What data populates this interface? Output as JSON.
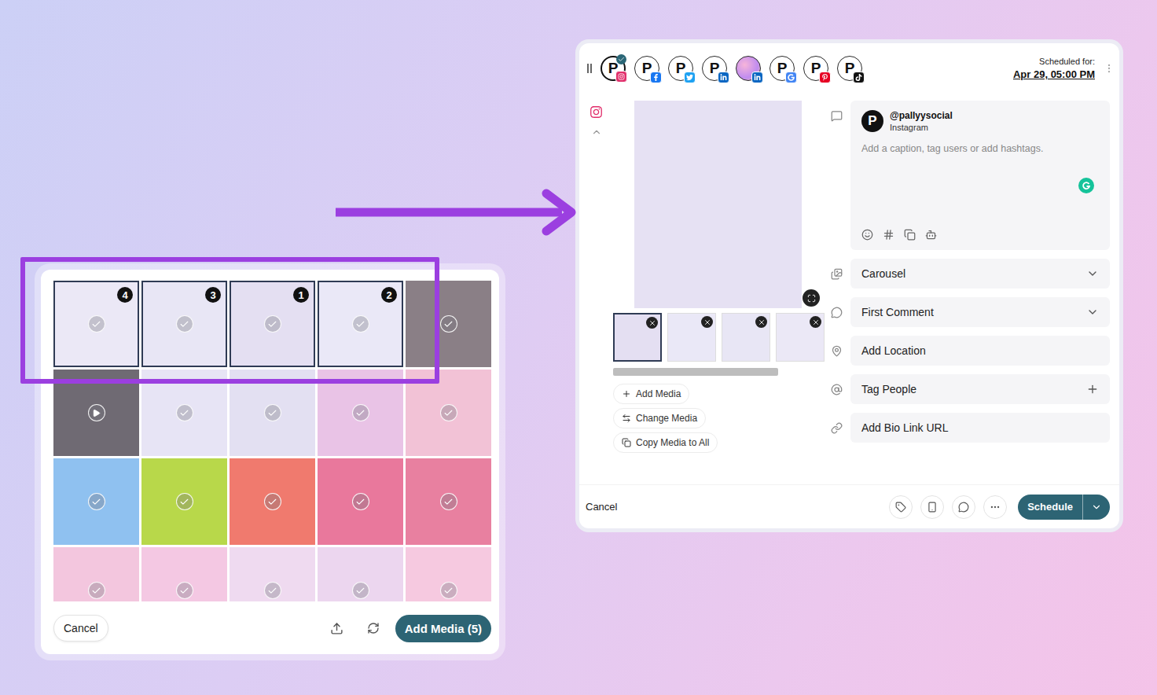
{
  "media_picker": {
    "thumbnails": [
      {
        "kind": "image",
        "color": "#ebe8f6",
        "selected": true,
        "order": "4"
      },
      {
        "kind": "image",
        "color": "#e8e6f5",
        "selected": true,
        "order": "3"
      },
      {
        "kind": "image",
        "color": "#e4dff2",
        "selected": true,
        "order": "1"
      },
      {
        "kind": "image",
        "color": "#eae8f7",
        "selected": true,
        "order": "2"
      },
      {
        "kind": "image",
        "color": "#8a7f86",
        "selected": false,
        "order": ""
      },
      {
        "kind": "video",
        "color": "#6f6a73",
        "selected": false,
        "order": ""
      },
      {
        "kind": "image",
        "color": "#e7e4f5",
        "selected": false,
        "order": ""
      },
      {
        "kind": "image",
        "color": "#e3e0f2",
        "selected": false,
        "order": ""
      },
      {
        "kind": "image",
        "color": "#e9c3e6",
        "selected": false,
        "order": ""
      },
      {
        "kind": "image",
        "color": "#f2c2d6",
        "selected": false,
        "order": ""
      },
      {
        "kind": "image",
        "color": "#8fc1f0",
        "selected": false,
        "order": ""
      },
      {
        "kind": "image",
        "color": "#b8d84a",
        "selected": false,
        "order": ""
      },
      {
        "kind": "image",
        "color": "#f07a6e",
        "selected": false,
        "order": ""
      },
      {
        "kind": "image",
        "color": "#e9789c",
        "selected": false,
        "order": ""
      },
      {
        "kind": "image",
        "color": "#e880a0",
        "selected": false,
        "order": ""
      },
      {
        "kind": "image",
        "color": "#f3c6de",
        "selected": false,
        "order": ""
      },
      {
        "kind": "image",
        "color": "#f4c8e3",
        "selected": false,
        "order": ""
      },
      {
        "kind": "image",
        "color": "#efdaf0",
        "selected": false,
        "order": ""
      },
      {
        "kind": "image",
        "color": "#ecd6ef",
        "selected": false,
        "order": ""
      },
      {
        "kind": "image",
        "color": "#f6c9e0",
        "selected": false,
        "order": ""
      }
    ],
    "cancel": "Cancel",
    "add": "Add Media (5)"
  },
  "composer": {
    "accounts": [
      {
        "platform": "instagram",
        "kind": "logo",
        "selected": true
      },
      {
        "platform": "facebook",
        "kind": "logo",
        "selected": false
      },
      {
        "platform": "twitter",
        "kind": "logo",
        "selected": false
      },
      {
        "platform": "linkedin",
        "kind": "logo",
        "selected": false
      },
      {
        "platform": "linkedin",
        "kind": "photo",
        "selected": false
      },
      {
        "platform": "google",
        "kind": "logo",
        "selected": false
      },
      {
        "platform": "pinterest",
        "kind": "logo",
        "selected": false
      },
      {
        "platform": "tiktok",
        "kind": "logo",
        "selected": false
      }
    ],
    "logo": "P",
    "schedule": {
      "label": "Scheduled for:",
      "value": "Apr 29, 05:00 PM"
    },
    "preview": {
      "color": "#e6e1f3"
    },
    "media_strip": [
      {
        "color": "#e4dff2",
        "selected": true
      },
      {
        "color": "#eae8f7",
        "selected": false
      },
      {
        "color": "#e8e6f5",
        "selected": false
      },
      {
        "color": "#ebe8f6",
        "selected": false
      }
    ],
    "media_actions": [
      {
        "label": "Add Media",
        "kind": "add"
      },
      {
        "label": "Change Media",
        "kind": "change"
      },
      {
        "label": "Copy Media to All",
        "kind": "copy"
      }
    ],
    "profile": {
      "handle": "@pallyysocial",
      "network": "Instagram"
    },
    "caption": {
      "placeholder": "Add a caption, tag users or add hashtags."
    },
    "fields": [
      {
        "label": "Carousel",
        "kind": "dropdown",
        "icon": "images"
      },
      {
        "label": "First Comment",
        "kind": "dropdown",
        "icon": "comment"
      },
      {
        "label": "Add Location",
        "kind": "plain",
        "icon": "location"
      },
      {
        "label": "Tag People",
        "kind": "add",
        "icon": "at"
      },
      {
        "label": "Add Bio Link URL",
        "kind": "plain",
        "icon": "link"
      }
    ],
    "footer": {
      "cancel": "Cancel",
      "schedule": "Schedule"
    }
  }
}
